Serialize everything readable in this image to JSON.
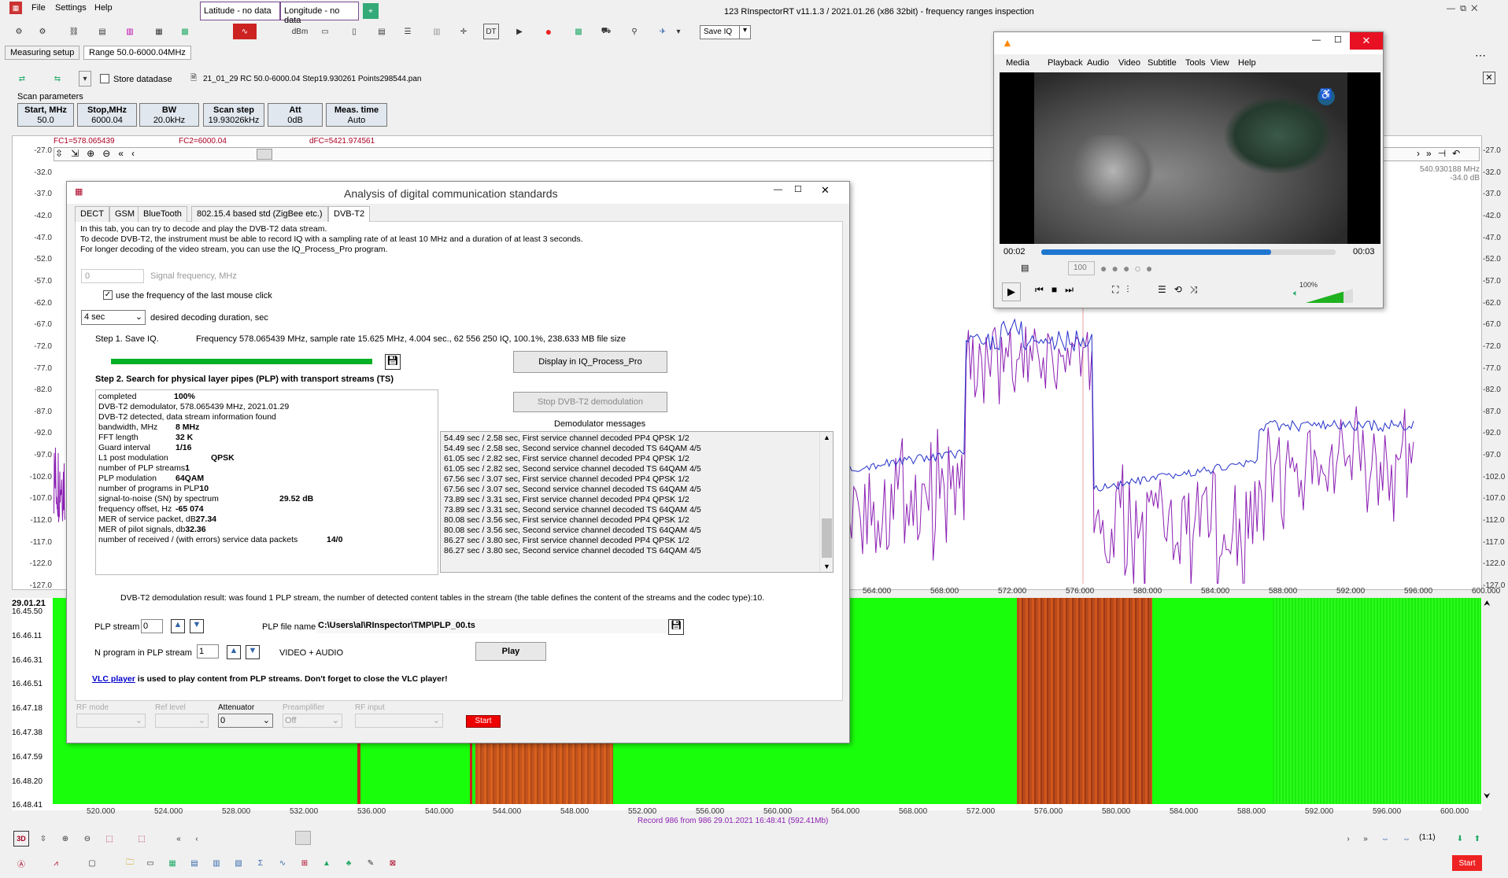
{
  "menu": {
    "file": "File",
    "settings": "Settings",
    "help": "Help"
  },
  "fields": {
    "latitude": "Latitude - no data",
    "longitude": "Longitude - no data"
  },
  "window_title": "123 RInspectorRT v11.1.3 / 2021.01.26 (x86 32bit) - frequency ranges inspection",
  "toolbar": {
    "dbm": "dBm",
    "save_iq": "Save IQ",
    "dt": "DT"
  },
  "tabs": {
    "measuring_setup": "Measuring setup",
    "range": "Range 50.0-6000.04MHz"
  },
  "store_database": "Store datadase",
  "file_label": "21_01_29 RC 50.0-6000.04 Step19.930261 Points298544.pan",
  "scan": {
    "group": "Scan parameters",
    "buttons": [
      {
        "title": "Start, MHz",
        "value": "50.0"
      },
      {
        "title": "Stop,MHz",
        "value": "6000.04"
      },
      {
        "title": "BW",
        "value": "20.0kHz"
      },
      {
        "title": "Scan step",
        "value": "19.93026kHz"
      },
      {
        "title": "Att",
        "value": "0dB"
      },
      {
        "title": "Meas. time",
        "value": "Auto"
      }
    ]
  },
  "markers": {
    "fc1": "FC1=578.065439",
    "fc2": "FC2=6000.04",
    "dfc": "dFC=5421.974561"
  },
  "spectrum": {
    "y_ticks": [
      "-27.0",
      "-32.0",
      "-37.0",
      "-42.0",
      "-47.0",
      "-52.0",
      "-57.0",
      "-62.0",
      "-67.0",
      "-72.0",
      "-77.0",
      "-82.0",
      "-87.0",
      "-92.0",
      "-97.0",
      "-102.0",
      "-107.0",
      "-112.0",
      "-117.0",
      "-122.0",
      "-127.0"
    ],
    "x_ticks": [
      "564.000",
      "568.000",
      "572.000",
      "576.000",
      "580.000",
      "584.000",
      "588.000",
      "592.000",
      "596.000",
      "600.000"
    ],
    "cursor_readout": [
      "540.930188 MHz",
      "-34.0 dB"
    ]
  },
  "waterfall": {
    "date": "29.01.21",
    "times": [
      "16.45.50",
      "16.46.11",
      "16.46.31",
      "16.46.51",
      "16.47.18",
      "16.47.38",
      "16.47.59",
      "16.48.20",
      "16.48.41"
    ],
    "x_ticks": [
      "520.000",
      "524.000",
      "528.000",
      "532.000",
      "536.000",
      "540.000",
      "544.000",
      "548.000",
      "552.000",
      "556.000",
      "560.000",
      "564.000",
      "568.000",
      "572.000",
      "576.000",
      "580.000",
      "584.000",
      "588.000",
      "592.000",
      "596.000",
      "600.000"
    ],
    "record": "Record 986  from 986   29.01.2021 16:48:41 (592.41Mb)",
    "zoom": "(1:1)"
  },
  "dialog": {
    "title": "Analysis of digital communication standards",
    "tabs": [
      "DECT",
      "GSM",
      "BlueTooth",
      "802.15.4 based std (ZigBee etc.)",
      "DVB-T2"
    ],
    "intro": [
      "In this tab, you can try to decode and play the DVB-T2 data stream.",
      "To decode DVB-T2, the instrument must be able to record IQ with a sampling rate of at least 10 MHz and a duration of at least 3 seconds.",
      "For longer decoding of the video stream, you can use the IQ_Process_Pro program."
    ],
    "signal_freq_value": "0",
    "signal_freq_label": "Signal frequency, MHz",
    "use_last_click": "use the frequency of the last mouse click",
    "duration_value": "4 sec",
    "duration_label": "desired decoding duration, sec",
    "step1": "Step 1. Save IQ.",
    "step1_info": "Frequency 578.065439 MHz, sample rate 15.625 MHz, 4.004 sec.,  62 556 250 IQ,   100.1%,  238.633 MB file size",
    "progress": 1.0,
    "display_btn": "Display in IQ_Process_Pro",
    "step2": "Step 2. Search for physical layer pipes (PLP) with transport streams (TS)",
    "stop_btn": "Stop DVB-T2 demodulation",
    "demod_label": "Demodulator messages",
    "results": [
      {
        "k": "completed",
        "v": "100%"
      },
      {
        "k": "DVB-T2 demodulator, 578.065439 MHz, 2021.01.29",
        "v": ""
      },
      {
        "k": "DVB-T2 detected, data stream information found",
        "v": ""
      },
      {
        "k": "bandwidth, MHz",
        "v": "8 MHz"
      },
      {
        "k": "FFT length",
        "v": "32 K"
      },
      {
        "k": "Guard interval",
        "v": "1/16"
      },
      {
        "k": "L1 post modulation",
        "v": "QPSK"
      },
      {
        "k": "number of PLP streams",
        "v": "1"
      },
      {
        "k": "PLP modulation",
        "v": "64QAM"
      },
      {
        "k": "number of programs in PLP",
        "v": "10"
      },
      {
        "k": "signal-to-noise (SN) by spectrum",
        "v": "29.52 dB"
      },
      {
        "k": "frequency offset, Hz",
        "v": "-65 074"
      },
      {
        "k": "MER of service packet, dB",
        "v": "27.34"
      },
      {
        "k": "MER of pilot signals, db",
        "v": "32.36"
      },
      {
        "k": "number of received / (with errors) service data packets",
        "v": "14/0"
      }
    ],
    "messages": [
      "54.49 sec / 2.58 sec, First service channel decoded  PP4 QPSK 1/2",
      "54.49 sec / 2.58 sec, Second service channel decoded  TS 64QAM 4/5",
      "61.05 sec / 2.82 sec, First service channel decoded  PP4 QPSK 1/2",
      "61.05 sec / 2.82 sec, Second service channel decoded  TS 64QAM 4/5",
      "67.56 sec / 3.07 sec, First service channel decoded  PP4 QPSK 1/2",
      "67.56 sec / 3.07 sec, Second service channel decoded  TS 64QAM 4/5",
      "73.89 sec / 3.31 sec, First service channel decoded  PP4 QPSK 1/2",
      "73.89 sec / 3.31 sec, Second service channel decoded  TS 64QAM 4/5",
      "80.08 sec / 3.56 sec, First service channel decoded  PP4 QPSK 1/2",
      "80.08 sec / 3.56 sec, Second service channel decoded  TS 64QAM 4/5",
      "86.27 sec / 3.80 sec, First service channel decoded  PP4 QPSK 1/2",
      "86.27 sec / 3.80 sec, Second service channel decoded  TS 64QAM 4/5"
    ],
    "result_text": "DVB-T2 demodulation result: was found 1 PLP stream, the number of detected content tables in the stream (the table defines the content of the streams and the codec type):10.",
    "plp_stream_label": "PLP stream",
    "plp_stream_value": "0",
    "plp_file_label": "PLP file name",
    "plp_file_value": "C:\\Users\\al\\RInspector\\TMP\\PLP_00.ts",
    "n_program_label": "N program in PLP stream",
    "n_program_value": "1",
    "video_audio": "VIDEO + AUDIO",
    "play_btn": "Play",
    "vlc_link": "VLC player",
    "vlc_note": " is used to play content from PLP streams. Don't forget to close the VLC player!",
    "bottom": {
      "rf_mode": "RF mode",
      "ref_level": "Ref level",
      "attenuator": "Attenuator",
      "att_value": "0",
      "preamp": "Preamplifier",
      "preamp_value": "Off",
      "rf_input": "RF input",
      "start": "Start"
    }
  },
  "vlc": {
    "menu": [
      "Media",
      "Playback",
      "Audio",
      "Video",
      "Subtitle",
      "Tools",
      "View",
      "Help"
    ],
    "time_current": "00:02",
    "time_total": "00:03",
    "speed_value": "100",
    "volume": "100%",
    "seek_fraction": 0.78
  },
  "bottom_start": "Start"
}
